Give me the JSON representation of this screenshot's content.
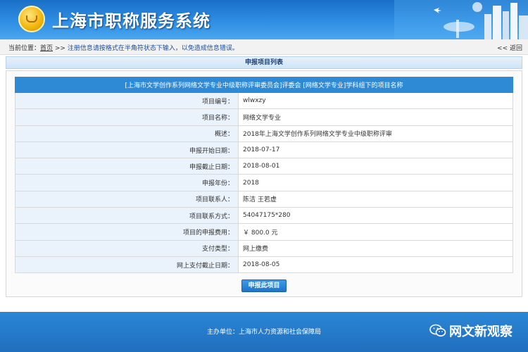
{
  "header": {
    "title": "上海市职称服务系统",
    "colors": {
      "banner": "#2f8ee3",
      "logo": "#f2b40a"
    }
  },
  "breadcrumb": {
    "prefix": "当前位置：",
    "home": "首页",
    "sep": " >> ",
    "note": "注册信息请按格式在半角符状态下输入，以免造成信息错误。",
    "back": "<< 返回"
  },
  "section": {
    "title": "申报项目列表"
  },
  "table": {
    "header": "[上海市文学创作系列网络文学专业中级职称评审委员会]评委会 [网络文学专业]学科组下的项目名称",
    "rows": [
      {
        "label": "项目编号：",
        "value": "wlwxzy"
      },
      {
        "label": "项目名称：",
        "value": "网络文学专业"
      },
      {
        "label": "概述：",
        "value": "2018年上海文学创作系列网络文学专业中级职称评审"
      },
      {
        "label": "申报开始日期：",
        "value": "2018-07-17"
      },
      {
        "label": "申报截止日期：",
        "value": "2018-08-01"
      },
      {
        "label": "申报年份：",
        "value": "2018"
      },
      {
        "label": "项目联系人：",
        "value": "陈洁 王若虚"
      },
      {
        "label": "项目联系方式：",
        "value": "54047175*280"
      },
      {
        "label": "项目的申报费用：",
        "value": "￥ 800.0 元"
      },
      {
        "label": "支付类型：",
        "value": "网上缴费"
      },
      {
        "label": "网上支付截止日期：",
        "value": "2018-08-05"
      }
    ]
  },
  "actions": {
    "submit_label": "申报此项目"
  },
  "footer": {
    "host": "主办单位：上海市人力资源和社会保障局",
    "watermark": "网文新观察"
  }
}
